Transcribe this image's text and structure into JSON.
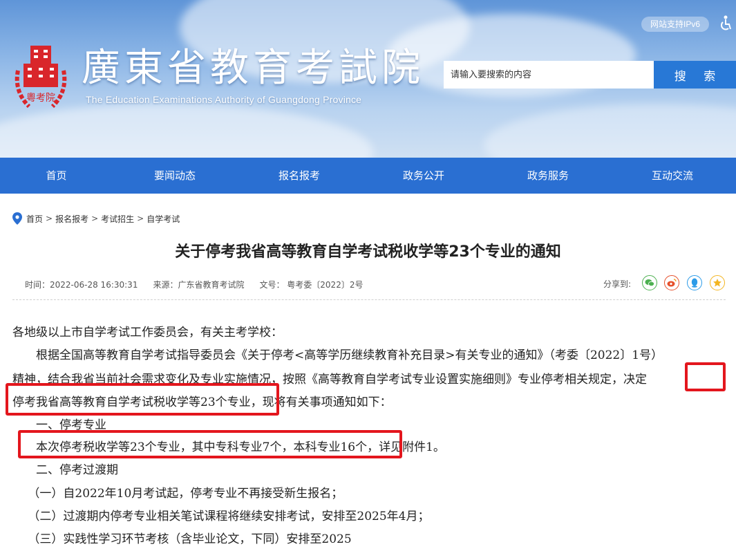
{
  "header": {
    "ipv6_label": "网站支持IPv6",
    "site_title": "廣東省教育考試院",
    "site_subtitle": "The Education Examinations Authority of Guangdong Province",
    "emblem_text": "粵考院",
    "search_placeholder": "请输入要搜索的内容",
    "search_button": "搜 索"
  },
  "nav": {
    "items": [
      "首页",
      "要闻动态",
      "报名报考",
      "政务公开",
      "政务服务",
      "互动交流"
    ]
  },
  "breadcrumb": {
    "items": [
      "首页",
      "报名报考",
      "考试招生",
      "自学考试"
    ],
    "separator": ">"
  },
  "article": {
    "title": "关于停考我省高等教育自学考试税收学等23个专业的通知",
    "time": "时间：2022-06-28 16:30:31",
    "source": "来源：广东省教育考试院",
    "doc_no": "文号： 粤考委〔2022〕2号",
    "share_label": "分享到:",
    "share_icons": [
      "wechat-icon",
      "weibo-icon",
      "qq-icon",
      "qzone-icon"
    ],
    "lines": [
      "各地级以上市自学考试工作委员会，有关主考学校：",
      "　　根据全国高等教育自学考试指导委员会《关于停考<高等学历继续教育补充目录>有关专业的通知》（考委〔2022〕1号）",
      "精神，结合我省当前社会需求变化及专业实施情况，按照《高等教育自学考试专业设置实施细则》专业停考相关规定，决定",
      "停考我省高等教育自学考试税收学等23个专业，现将有关事项通知如下：",
      "　　一、停考专业",
      "　　本次停考税收学等23个专业，其中专科专业7个，本科专业16个，详见附件1。",
      "　　二、停考过渡期",
      "　 （一）自2022年10月考试起，停考专业不再接受新生报名；",
      "　 （二）过渡期内停考专业相关笔试课程将继续安排考试，安排至2025年4月；",
      "　 （三）实践性学习环节考核（含毕业论文，下同）安排至2025"
    ]
  },
  "colors": {
    "nav_bg": "#2a6fd2",
    "search_button_bg": "#2878d6",
    "highlight_border": "#e3161d"
  }
}
